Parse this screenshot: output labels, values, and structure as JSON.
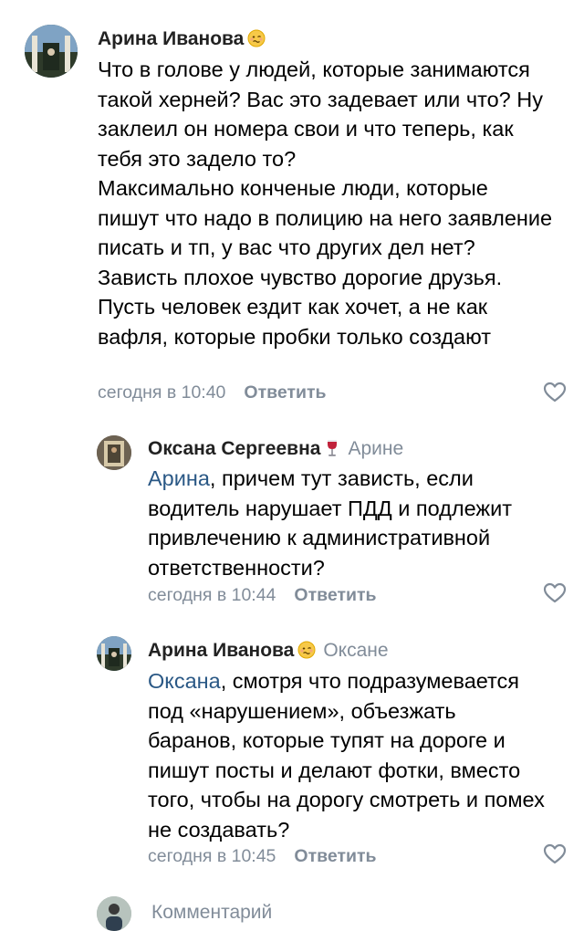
{
  "comments": [
    {
      "author": "Арина Иванова",
      "author_emoji": "woozy-face",
      "text": "Что в голове у людей, которые занимаются такой херней? Вас это задевает или что? Ну заклеил он номера свои и что теперь, как тебя это задело то?\nМаксимально конченые люди, которые пишут что надо в полицию на него заявление писать и тп, у вас что других дел нет? Зависть плохое чувство дорогие друзья.\nПусть человек ездит как хочет, а не как вафля, которые пробки только создают",
      "date": "сегодня в 10:40",
      "reply_label": "Ответить"
    },
    {
      "author": "Оксана Сергеевна",
      "author_emoji": "wine-glass",
      "reply_to": "Арине",
      "mention": "Арина",
      "text": ", причем тут зависть, если водитель нарушает ПДД и подлежит привлечению к административной ответственности?",
      "date": "сегодня в 10:44",
      "reply_label": "Ответить"
    },
    {
      "author": "Арина Иванова",
      "author_emoji": "woozy-face",
      "reply_to": "Оксане",
      "mention": "Оксана",
      "text": ", смотря что подразумевается под «нарушением», объезжать баранов, которые тупят на дороге и пишут посты и делают фотки, вместо того, чтобы на дорогу смотреть и помех не создавать?",
      "date": "сегодня в 10:45",
      "reply_label": "Ответить"
    }
  ],
  "composer": {
    "placeholder": "Комментарий"
  },
  "colors": {
    "secondary_text": "#818c99",
    "mention": "#2a5885",
    "primary_text": "#000000"
  }
}
